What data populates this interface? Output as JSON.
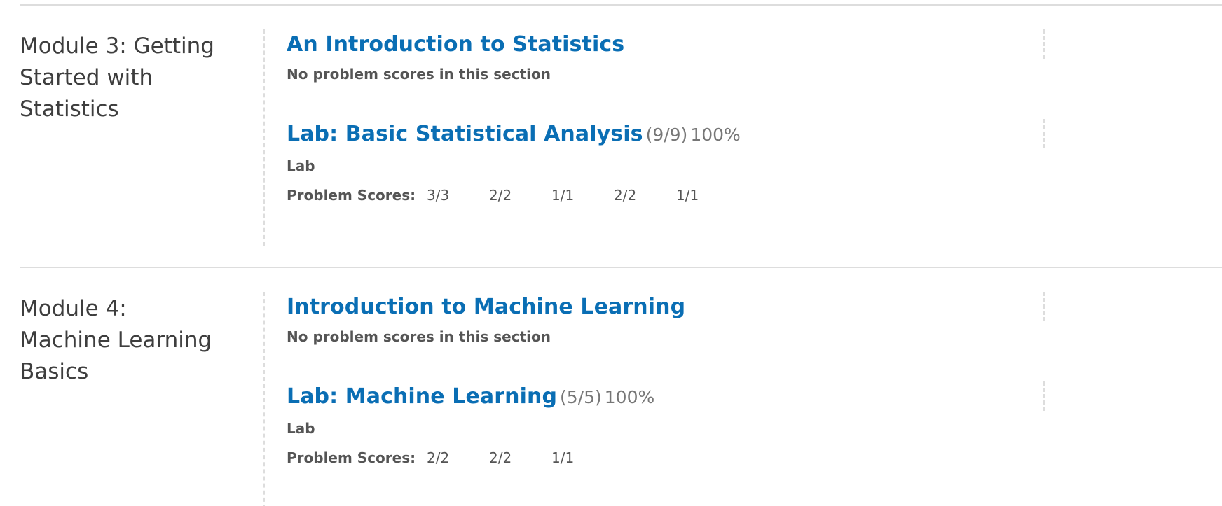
{
  "chapters": [
    {
      "title": "Module 3: Getting Started with Statistics",
      "sections": [
        {
          "title": "An Introduction to Statistics",
          "note": "No problem scores in this section"
        },
        {
          "title": "Lab: Basic Statistical Analysis",
          "score": "(9/9)",
          "percent": "100%",
          "format": "Lab",
          "scores_label": "Problem Scores:",
          "problem_scores": [
            "3/3",
            "2/2",
            "1/1",
            "2/2",
            "1/1"
          ]
        }
      ]
    },
    {
      "title": "Module 4: Machine Learning Basics",
      "sections": [
        {
          "title": "Introduction to Machine Learning",
          "note": "No problem scores in this section"
        },
        {
          "title": "Lab: Machine Learning",
          "score": "(5/5)",
          "percent": "100%",
          "format": "Lab",
          "scores_label": "Problem Scores:",
          "problem_scores": [
            "2/2",
            "2/2",
            "1/1"
          ]
        }
      ]
    }
  ],
  "colors": {
    "link": "#0a6eb4",
    "muted": "#767676",
    "text": "#555555",
    "heading": "#3e3e3e",
    "rule": "#dddddd"
  }
}
